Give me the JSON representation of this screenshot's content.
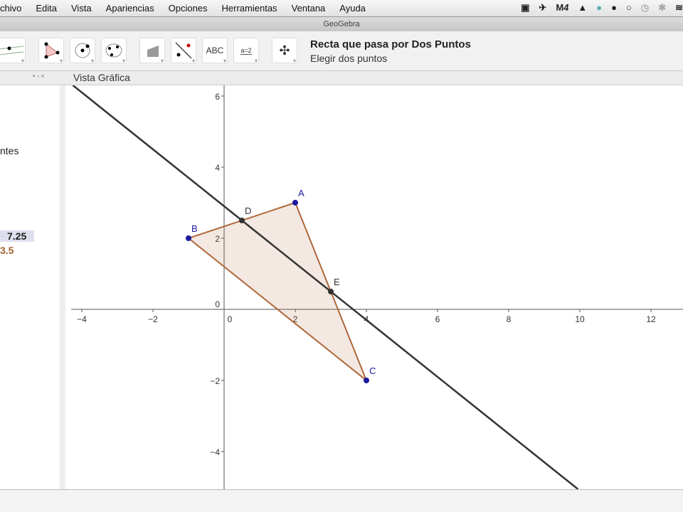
{
  "menubar": {
    "items": [
      "chivo",
      "Edita",
      "Vista",
      "Apariencias",
      "Opciones",
      "Herramientas",
      "Ventana",
      "Ayuda"
    ],
    "status_text": "4"
  },
  "window": {
    "title": "GeoGebra"
  },
  "toolbar": {
    "tools": [
      "line-tool",
      "polygon-tool",
      "circle-tool",
      "conic-tool",
      "area-tool",
      "perpendicular-tool",
      "text-tool",
      "slider-tool",
      "move-view-tool"
    ],
    "text_label": "ABC",
    "slider_label": "a=2",
    "active_tool_name": "Recta que pasa por Dos Puntos",
    "active_tool_help": "Elegir dos puntos"
  },
  "algebra": {
    "header_controls": "• ▫ ×",
    "section": "ntes",
    "value1": "7.25",
    "value2": "3.5"
  },
  "graphics": {
    "title": "Vista Gráfica",
    "x_ticks": [
      -4,
      -2,
      0,
      2,
      4,
      6,
      8,
      10,
      12
    ],
    "y_ticks": [
      -4,
      -2,
      2,
      4,
      6
    ],
    "xlim": [
      -4.3,
      12.9
    ],
    "ylim": [
      -5.06,
      6.3
    ],
    "points": [
      {
        "name": "A",
        "x": 2,
        "y": 3,
        "color": "#1a1aa0"
      },
      {
        "name": "B",
        "x": -1,
        "y": 2,
        "color": "#1a1aa0"
      },
      {
        "name": "C",
        "x": 4,
        "y": -2,
        "color": "#1a1aa0"
      },
      {
        "name": "D",
        "x": 0.5,
        "y": 2.5,
        "color": "#333333"
      },
      {
        "name": "E",
        "x": 3,
        "y": 0.5,
        "color": "#333333"
      }
    ],
    "polygon": [
      "A",
      "B",
      "C"
    ],
    "line": [
      "D",
      "E"
    ],
    "polygon_color": "#b0683a"
  }
}
